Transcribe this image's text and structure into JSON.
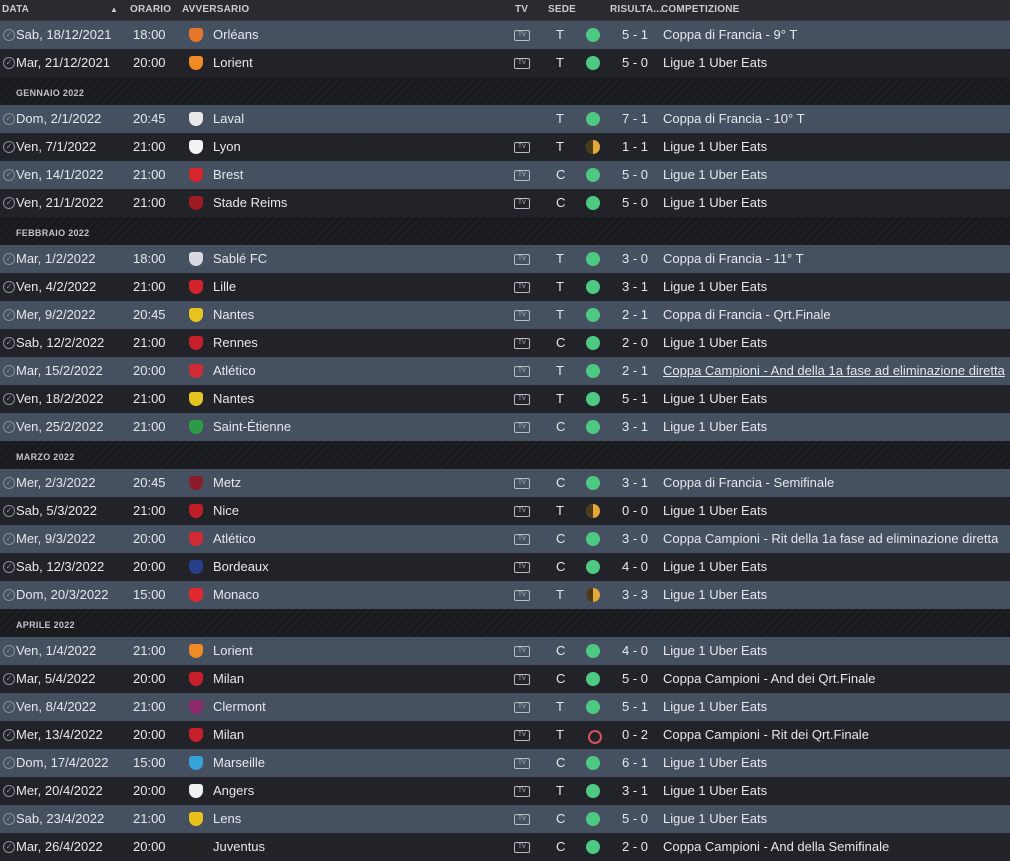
{
  "header": {
    "date": "DATA",
    "time": "ORARIO",
    "opponent": "AVVERSARIO",
    "tv": "TV",
    "venue": "SEDE",
    "result": "RISULTA...",
    "competition": "COMPETIZIONE"
  },
  "colors": {
    "win": "#4ec982",
    "draw": "#e3a93a",
    "loss": "#d8515a"
  },
  "groups": [
    {
      "month": "",
      "rows": [
        {
          "date": "Sab, 18/12/2021",
          "time": "18:00",
          "opp": "Orléans",
          "tv": true,
          "venue": "T",
          "result": "win",
          "score": "5 - 1",
          "comp": "Coppa di Francia - 9° T",
          "crest": "#e4762a"
        },
        {
          "date": "Mar, 21/12/2021",
          "time": "20:00",
          "opp": "Lorient",
          "tv": true,
          "venue": "T",
          "result": "win",
          "score": "5 - 0",
          "comp": "Ligue 1 Uber Eats",
          "crest": "#f08a24"
        }
      ]
    },
    {
      "month": "GENNAIO 2022",
      "rows": [
        {
          "date": "Dom, 2/1/2022",
          "time": "20:45",
          "opp": "Laval",
          "tv": false,
          "venue": "T",
          "result": "win",
          "score": "7 - 1",
          "comp": "Coppa di Francia - 10° T",
          "crest": "#e8e8e8"
        },
        {
          "date": "Ven, 7/1/2022",
          "time": "21:00",
          "opp": "Lyon",
          "tv": true,
          "venue": "T",
          "result": "draw",
          "score": "1 - 1",
          "comp": "Ligue 1 Uber Eats",
          "crest": "#f2f2f2"
        },
        {
          "date": "Ven, 14/1/2022",
          "time": "21:00",
          "opp": "Brest",
          "tv": true,
          "venue": "C",
          "result": "win",
          "score": "5 - 0",
          "comp": "Ligue 1 Uber Eats",
          "crest": "#d8252c"
        },
        {
          "date": "Ven, 21/1/2022",
          "time": "21:00",
          "opp": "Stade Reims",
          "tv": true,
          "venue": "C",
          "result": "win",
          "score": "5 - 0",
          "comp": "Ligue 1 Uber Eats",
          "crest": "#9e1b22"
        }
      ]
    },
    {
      "month": "FEBBRAIO 2022",
      "rows": [
        {
          "date": "Mar, 1/2/2022",
          "time": "18:00",
          "opp": "Sablé FC",
          "tv": true,
          "venue": "T",
          "result": "win",
          "score": "3 - 0",
          "comp": "Coppa di Francia - 11° T",
          "crest": "#d8d8e0"
        },
        {
          "date": "Ven, 4/2/2022",
          "time": "21:00",
          "opp": "Lille",
          "tv": true,
          "venue": "T",
          "result": "win",
          "score": "3 - 1",
          "comp": "Ligue 1 Uber Eats",
          "crest": "#d2232a"
        },
        {
          "date": "Mer, 9/2/2022",
          "time": "20:45",
          "opp": "Nantes",
          "tv": true,
          "venue": "T",
          "result": "win",
          "score": "2 - 1",
          "comp": "Coppa di Francia - Qrt.Finale",
          "crest": "#e6c31e"
        },
        {
          "date": "Sab, 12/2/2022",
          "time": "21:00",
          "opp": "Rennes",
          "tv": true,
          "venue": "C",
          "result": "win",
          "score": "2 - 0",
          "comp": "Ligue 1 Uber Eats",
          "crest": "#c8202a"
        },
        {
          "date": "Mar, 15/2/2022",
          "time": "20:00",
          "opp": "Atlético",
          "tv": true,
          "venue": "T",
          "result": "win",
          "score": "2 - 1",
          "comp": "Coppa Campioni - And della 1a fase ad eliminazione diretta",
          "crest": "#cf2a36",
          "link": true
        },
        {
          "date": "Ven, 18/2/2022",
          "time": "21:00",
          "opp": "Nantes",
          "tv": true,
          "venue": "T",
          "result": "win",
          "score": "5 - 1",
          "comp": "Ligue 1 Uber Eats",
          "crest": "#e6c31e"
        },
        {
          "date": "Ven, 25/2/2022",
          "time": "21:00",
          "opp": "Saint-Étienne",
          "tv": true,
          "venue": "C",
          "result": "win",
          "score": "3 - 1",
          "comp": "Ligue 1 Uber Eats",
          "crest": "#2f9a46"
        }
      ]
    },
    {
      "month": "MARZO 2022",
      "rows": [
        {
          "date": "Mer, 2/3/2022",
          "time": "20:45",
          "opp": "Metz",
          "tv": true,
          "venue": "C",
          "result": "win",
          "score": "3 - 1",
          "comp": "Coppa di Francia - Semifinale",
          "crest": "#8a1c2c"
        },
        {
          "date": "Sab, 5/3/2022",
          "time": "21:00",
          "opp": "Nice",
          "tv": true,
          "venue": "T",
          "result": "draw",
          "score": "0 - 0",
          "comp": "Ligue 1 Uber Eats",
          "crest": "#c01e26"
        },
        {
          "date": "Mer, 9/3/2022",
          "time": "20:00",
          "opp": "Atlético",
          "tv": true,
          "venue": "C",
          "result": "win",
          "score": "3 - 0",
          "comp": "Coppa Campioni - Rit della 1a fase ad eliminazione diretta",
          "crest": "#cf2a36"
        },
        {
          "date": "Sab, 12/3/2022",
          "time": "20:00",
          "opp": "Bordeaux",
          "tv": true,
          "venue": "C",
          "result": "win",
          "score": "4 - 0",
          "comp": "Ligue 1 Uber Eats",
          "crest": "#2a3f8a"
        },
        {
          "date": "Dom, 20/3/2022",
          "time": "15:00",
          "opp": "Monaco",
          "tv": true,
          "venue": "T",
          "result": "draw",
          "score": "3 - 3",
          "comp": "Ligue 1 Uber Eats",
          "crest": "#e0282e"
        }
      ]
    },
    {
      "month": "APRILE 2022",
      "rows": [
        {
          "date": "Ven, 1/4/2022",
          "time": "21:00",
          "opp": "Lorient",
          "tv": true,
          "venue": "C",
          "result": "win",
          "score": "4 - 0",
          "comp": "Ligue 1 Uber Eats",
          "crest": "#f08a24"
        },
        {
          "date": "Mar, 5/4/2022",
          "time": "20:00",
          "opp": "Milan",
          "tv": true,
          "venue": "C",
          "result": "win",
          "score": "5 - 0",
          "comp": "Coppa Campioni - And dei Qrt.Finale",
          "crest": "#c8202a"
        },
        {
          "date": "Ven, 8/4/2022",
          "time": "21:00",
          "opp": "Clermont",
          "tv": true,
          "venue": "T",
          "result": "win",
          "score": "5 - 1",
          "comp": "Ligue 1 Uber Eats",
          "crest": "#8e2a6e"
        },
        {
          "date": "Mer, 13/4/2022",
          "time": "20:00",
          "opp": "Milan",
          "tv": true,
          "venue": "T",
          "result": "loss",
          "score": "0 - 2",
          "comp": "Coppa Campioni - Rit dei Qrt.Finale",
          "crest": "#c8202a"
        },
        {
          "date": "Dom, 17/4/2022",
          "time": "15:00",
          "opp": "Marseille",
          "tv": true,
          "venue": "C",
          "result": "win",
          "score": "6 - 1",
          "comp": "Ligue 1 Uber Eats",
          "crest": "#35a3d8"
        },
        {
          "date": "Mer, 20/4/2022",
          "time": "20:00",
          "opp": "Angers",
          "tv": true,
          "venue": "T",
          "result": "win",
          "score": "3 - 1",
          "comp": "Ligue 1 Uber Eats",
          "crest": "#f0f0f0"
        },
        {
          "date": "Sab, 23/4/2022",
          "time": "21:00",
          "opp": "Lens",
          "tv": true,
          "venue": "C",
          "result": "win",
          "score": "5 - 0",
          "comp": "Ligue 1 Uber Eats",
          "crest": "#e8c21a"
        },
        {
          "date": "Mar, 26/4/2022",
          "time": "20:00",
          "opp": "Juventus",
          "tv": true,
          "venue": "C",
          "result": "win",
          "score": "2 - 0",
          "comp": "Coppa Campioni - And della Semifinale",
          "crest": "#222222"
        }
      ]
    }
  ]
}
